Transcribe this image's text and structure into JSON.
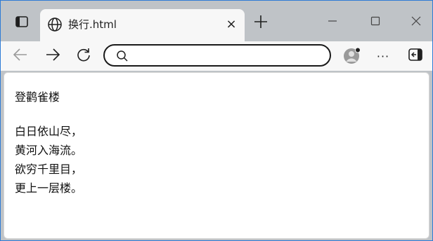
{
  "browser": {
    "tab": {
      "title": "换行.html",
      "favicon": "globe-icon",
      "close_label": "×"
    },
    "address_bar": {
      "value": "",
      "icon": "search-icon"
    },
    "toolbar": {
      "more_label": "···"
    }
  },
  "page": {
    "title": "登鹳雀楼",
    "lines": [
      "白日依山尽，",
      "黄河入海流。",
      "欲穷千里目，",
      "更上一层楼。"
    ]
  },
  "colors": {
    "chrome_bg": "#bfc3c7",
    "tab_bg": "#f7f7f7",
    "window_border": "#2e7bd6",
    "text": "#111111"
  }
}
